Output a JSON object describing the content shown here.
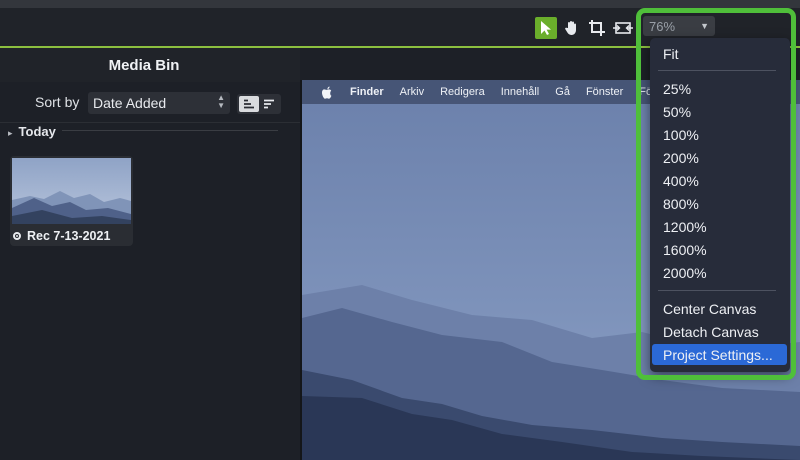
{
  "toolbar": {
    "zoom_value": "76%",
    "tools": [
      "select-tool",
      "hand-tool",
      "crop-tool",
      "pan-zoom-tool"
    ]
  },
  "media_bin": {
    "title": "Media Bin",
    "sort_label": "Sort by",
    "sort_value": "Date Added",
    "group_label": "Today",
    "items": [
      {
        "name": "Rec 7-13-2021"
      }
    ]
  },
  "canvas": {
    "menubar": {
      "items": [
        "Finder",
        "Arkiv",
        "Redigera",
        "Innehåll",
        "Gå",
        "Fönster",
        "Fö"
      ]
    }
  },
  "zoom_menu": {
    "fit": "Fit",
    "levels": [
      "25%",
      "50%",
      "100%",
      "200%",
      "400%",
      "800%",
      "1200%",
      "1600%",
      "2000%"
    ],
    "actions": [
      "Center Canvas",
      "Detach Canvas",
      "Project Settings..."
    ],
    "highlighted": "Project Settings..."
  },
  "colors": {
    "accent_green": "#6aae2b",
    "callout_green": "#4fbf3a",
    "menu_highlight": "#2b69d6"
  }
}
